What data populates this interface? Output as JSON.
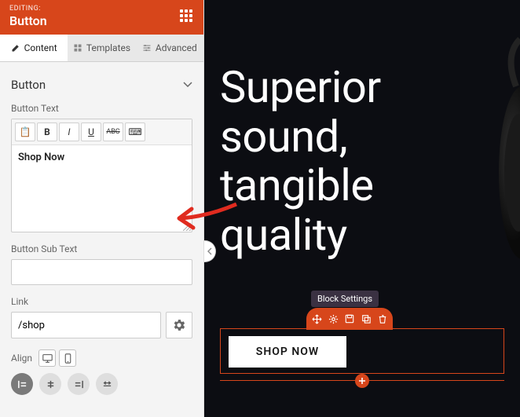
{
  "header": {
    "editing_label": "EDITING:",
    "title": "Button"
  },
  "tabs": {
    "content": "Content",
    "templates": "Templates",
    "advanced": "Advanced"
  },
  "section": {
    "title": "Button"
  },
  "fields": {
    "button_text_label": "Button Text",
    "button_text_value": "Shop Now",
    "button_subtext_label": "Button Sub Text",
    "button_subtext_value": "",
    "link_label": "Link",
    "link_value": "/shop",
    "align_label": "Align"
  },
  "editor_toolbar": {
    "paste": "📋",
    "bold": "B",
    "italic": "I",
    "underline": "U",
    "strike": "ABC",
    "keyboard": "⌨"
  },
  "canvas": {
    "hero_line1": "Superior",
    "hero_line2": "sound,",
    "hero_line3": "tangible",
    "hero_line4": "quality",
    "shop_button": "SHOP NOW",
    "tooltip": "Block Settings"
  },
  "colors": {
    "accent": "#d7461b"
  }
}
